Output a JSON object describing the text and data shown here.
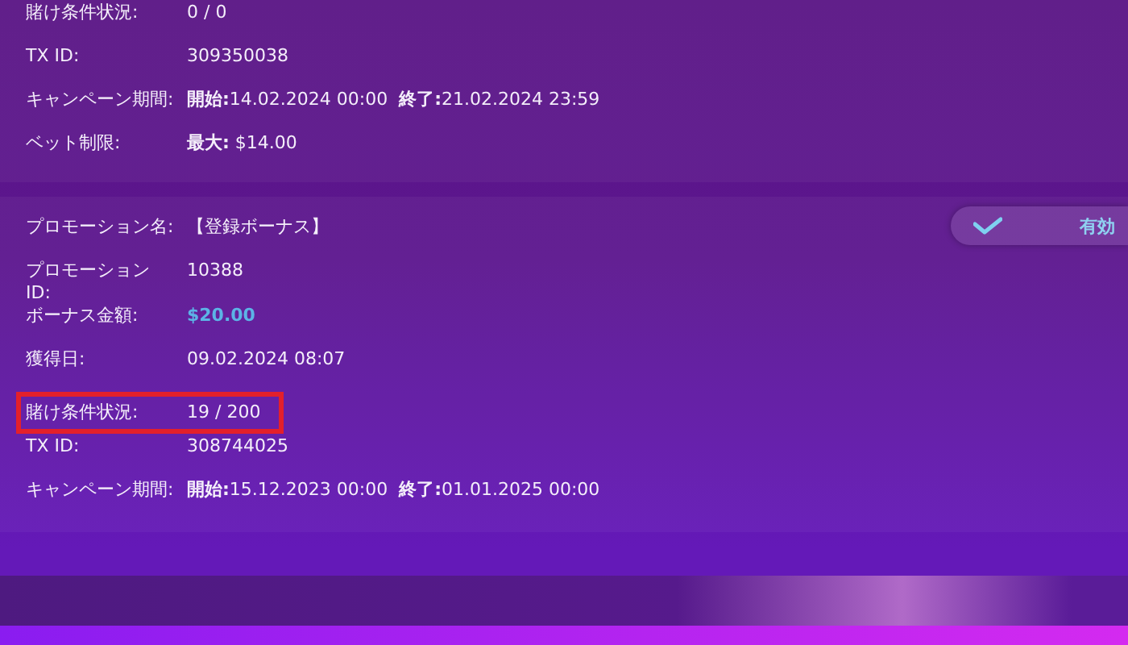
{
  "cards": [
    {
      "rows": [
        {
          "label": "賭け条件状況:",
          "value": "0 / 0",
          "kind": "text",
          "highlighted": false
        },
        {
          "label": "TX ID:",
          "value": "309350038",
          "kind": "text",
          "highlighted": false
        },
        {
          "label": "キャンペーン期間:",
          "value": "**開始:**14.02.2024 00:00  **終了:**21.02.2024 23:59",
          "kind": "text",
          "highlighted": false
        },
        {
          "label": "ベット制限:",
          "value": "**最大:** $14.00",
          "kind": "text",
          "highlighted": false
        }
      ]
    },
    {
      "status": {
        "label": "有効",
        "checked": true
      },
      "rows": [
        {
          "label": "プロモーション名:",
          "value": "【登録ボーナス】",
          "kind": "text",
          "highlighted": false
        },
        {
          "label": "プロモーション ID:",
          "value": "10388",
          "kind": "text",
          "highlighted": false
        },
        {
          "label": "ボーナス金額:",
          "value": "$20.00",
          "kind": "amount",
          "highlighted": false
        },
        {
          "label": "獲得日:",
          "value": "09.02.2024 08:07",
          "kind": "text",
          "highlighted": false
        },
        {
          "label": "賭け条件状況:",
          "value": "19 / 200",
          "kind": "text",
          "highlighted": true
        },
        {
          "label": "TX ID:",
          "value": "308744025",
          "kind": "text",
          "highlighted": false
        },
        {
          "label": "キャンペーン期間:",
          "value": "**開始:**15.12.2023 00:00  **終了:**01.01.2025 00:00",
          "kind": "text",
          "highlighted": false
        }
      ]
    }
  ]
}
